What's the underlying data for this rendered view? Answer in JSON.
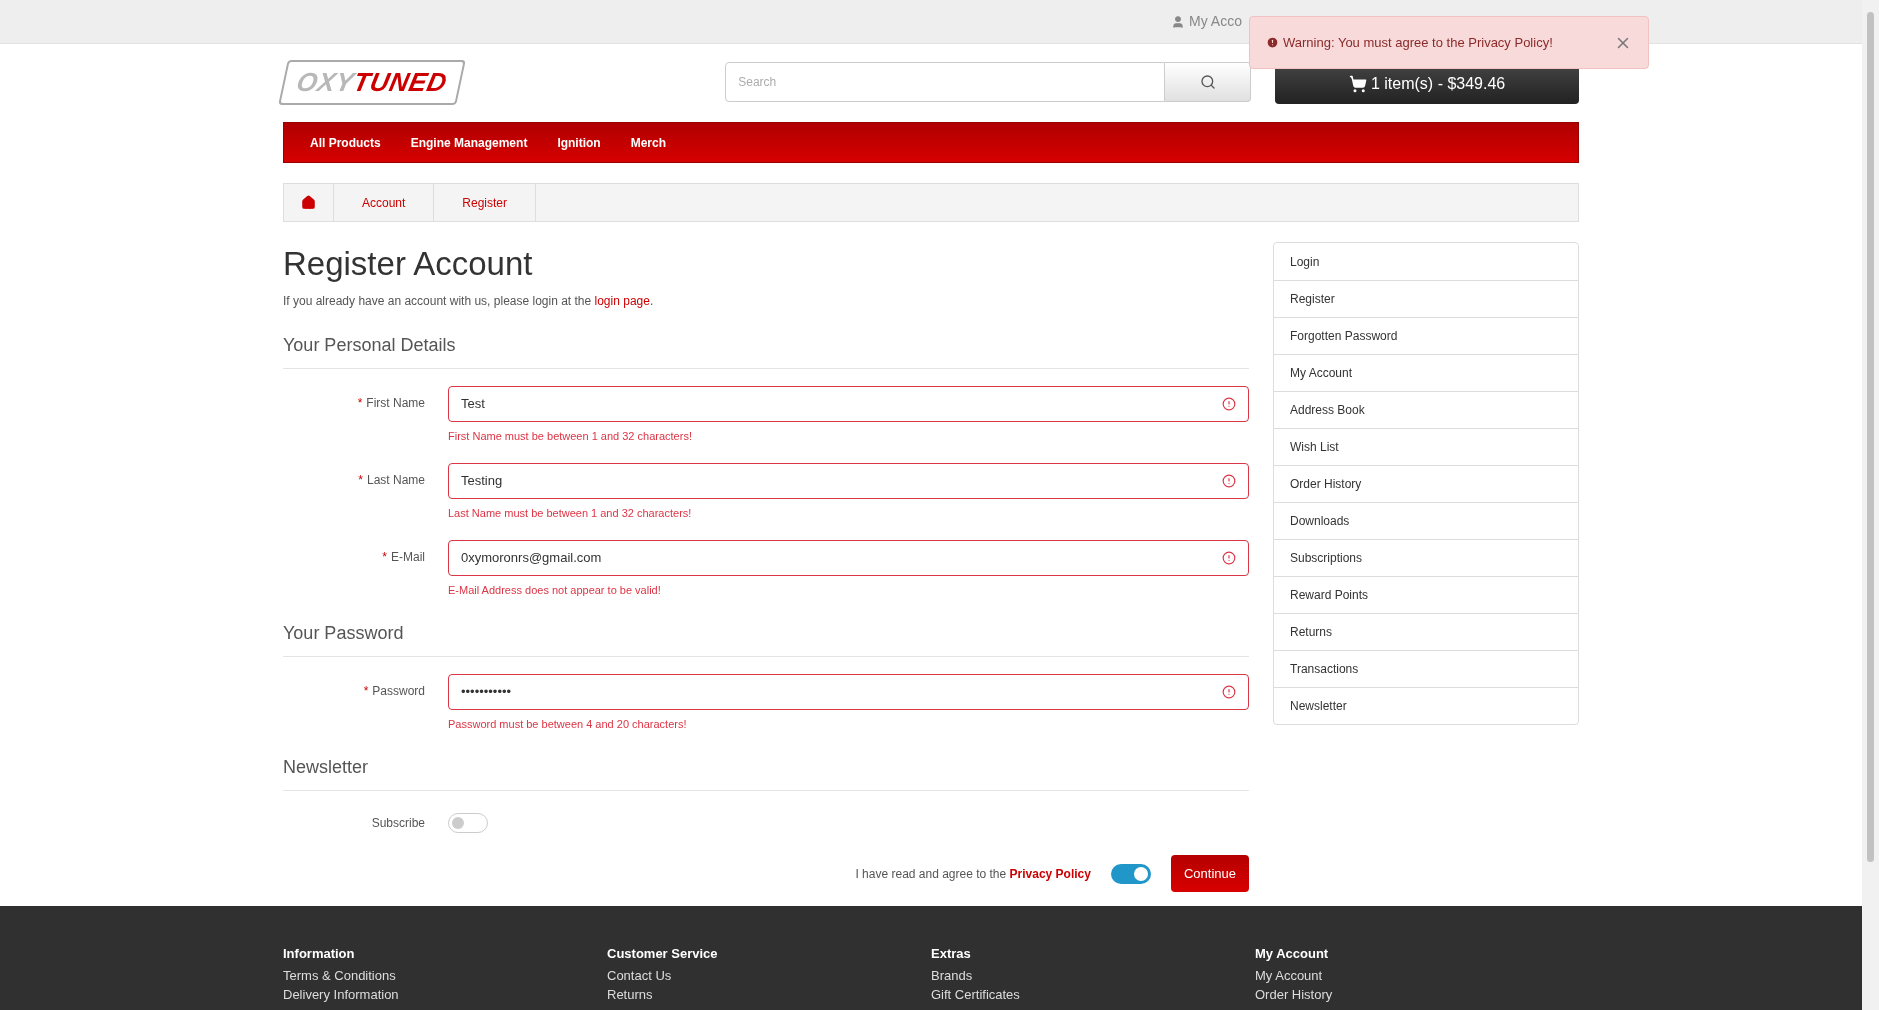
{
  "top_bar": {
    "account_link": "My Acco"
  },
  "alert": {
    "message": "Warning: You must agree to the Privacy Policy!"
  },
  "logo": {
    "part_1": "OXY",
    "part_2": "TUNED"
  },
  "search": {
    "placeholder": "Search"
  },
  "cart_button": "1 item(s) - $349.46",
  "nav": [
    "All Products",
    "Engine Management",
    "Ignition",
    "Merch"
  ],
  "breadcrumb": [
    "Account",
    "Register"
  ],
  "page": {
    "title": "Register Account",
    "intro": "If you already have an account with us, please login at the ",
    "intro_link": "login page",
    "intro_end": "."
  },
  "sections": [
    {
      "heading": "Your Personal Details",
      "fields": [
        {
          "label": "First Name",
          "required_mark": "*",
          "value": "Test",
          "invalid": true,
          "error": "First Name must be between 1 and 32 characters!"
        },
        {
          "label": "Last Name",
          "required_mark": "*",
          "value": "Testing",
          "invalid": true,
          "error": "Last Name must be between 1 and 32 characters!"
        },
        {
          "label": "E-Mail",
          "required_mark": "*",
          "value": "0xymoronrs@gmail.com",
          "invalid": true,
          "error": "E-Mail Address does not appear to be valid!"
        }
      ]
    },
    {
      "heading": "Your Password",
      "fields": [
        {
          "label": "Password",
          "required_mark": "*",
          "value": "•••••••••••",
          "invalid": true,
          "error": "Password must be between 4 and 20 characters!"
        }
      ]
    }
  ],
  "newsletter": {
    "heading": "Newsletter",
    "label": "Subscribe",
    "on": false
  },
  "agree": {
    "text": "I have read and agree to the ",
    "link": "Privacy Policy",
    "on": true
  },
  "continue_button": "Continue",
  "sidebar": {
    "items": [
      "Login",
      "Register",
      "Forgotten Password",
      "My Account",
      "Address Book",
      "Wish List",
      "Order History",
      "Downloads",
      "Subscriptions",
      "Reward Points",
      "Returns",
      "Transactions",
      "Newsletter"
    ]
  },
  "footer": {
    "columns": [
      {
        "heading": "Information",
        "links": [
          "Terms & Conditions",
          "Delivery Information"
        ]
      },
      {
        "heading": "Customer Service",
        "links": [
          "Contact Us",
          "Returns"
        ]
      },
      {
        "heading": "Extras",
        "links": [
          "Brands",
          "Gift Certificates"
        ]
      },
      {
        "heading": "My Account",
        "links": [
          "My Account",
          "Order History"
        ]
      }
    ]
  }
}
